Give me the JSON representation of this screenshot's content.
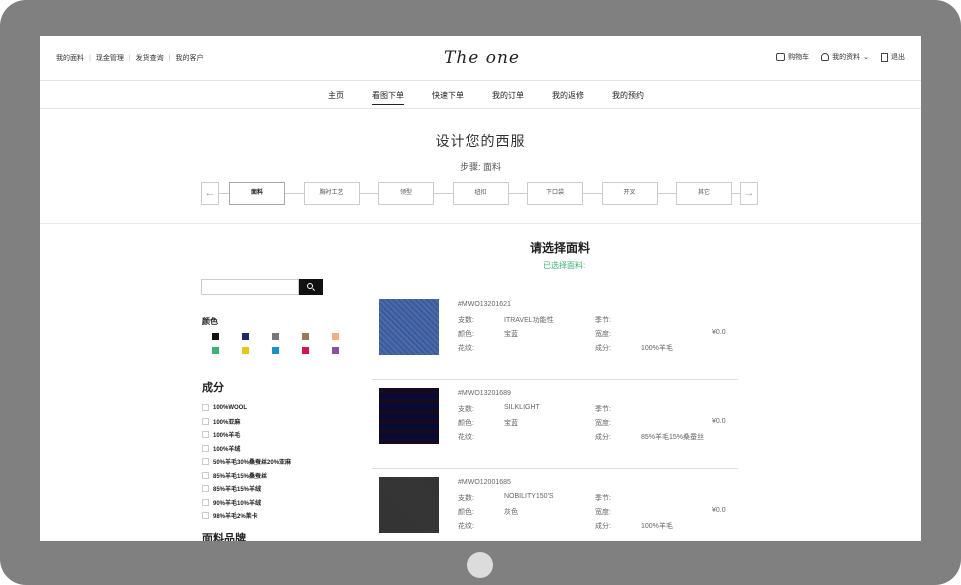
{
  "top_links": [
    "我的面料",
    "现金管理",
    "发货查询",
    "我的客户"
  ],
  "logo": "The one",
  "top_right": {
    "cart": "购物车",
    "profile": "我的资料",
    "logout": "退出"
  },
  "nav": [
    "主页",
    "看图下单",
    "快速下单",
    "我的订单",
    "我的返修",
    "我的预约"
  ],
  "nav_active": 1,
  "title": "设计您的西服",
  "step_text": "步骤: 面料",
  "steps": [
    "面料",
    "胸衬工艺",
    "领型",
    "纽扣",
    "下口袋",
    "开叉",
    "其它"
  ],
  "step_prev": "←",
  "step_next": "→",
  "select_title": "请选择面料",
  "selected_label": "已选择面料:",
  "search": {
    "value": ""
  },
  "color_label": "颜色",
  "colors": [
    "#111111",
    "#1b2a6b",
    "#777777",
    "#9a7a5a",
    "#f0b080",
    "#3cb371",
    "#e6c619",
    "#1a8fc9",
    "#d4145a",
    "#8a4fa8"
  ],
  "composition_label": "成分",
  "compositions": [
    "100%WOOL",
    "100%亚麻",
    "100%羊毛",
    "100%羊绒",
    "50%羊毛30%桑蚕丝20%亚麻",
    "85%羊毛15%桑蚕丝",
    "85%羊毛15%羊绒",
    "90%羊毛10%羊绒",
    "98%羊毛2%莱卡"
  ],
  "brand_label": "面料品牌",
  "fabric_labels": {
    "count": "支数:",
    "color": "颜色:",
    "pattern": "花纹:",
    "season": "季节:",
    "width": "宽度:",
    "composition": "成分:"
  },
  "fabrics": [
    {
      "code": "#MWO13201621",
      "count": "ITRAVEL功能性",
      "color": "宝蓝",
      "pattern": "",
      "season": "",
      "width": "",
      "composition": "100%羊毛",
      "price": "¥0.0",
      "swatch": "blue"
    },
    {
      "code": "#MWO13201689",
      "count": "SILKLIGHT",
      "color": "宝蓝",
      "pattern": "",
      "season": "",
      "width": "",
      "composition": "85%羊毛15%桑蚕丝",
      "price": "¥0.0",
      "swatch": "plaid"
    },
    {
      "code": "#MWO12001685",
      "count": "NOBILITY150'S",
      "color": "灰色",
      "pattern": "",
      "season": "",
      "width": "",
      "composition": "100%羊毛",
      "price": "¥0.0",
      "swatch": "gray"
    }
  ]
}
